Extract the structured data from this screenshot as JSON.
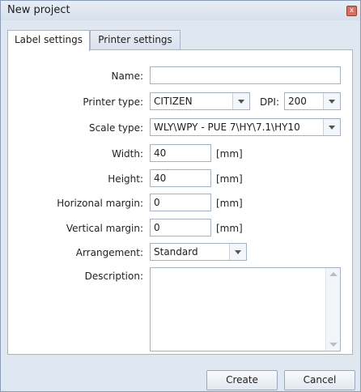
{
  "window": {
    "title": "New project"
  },
  "tabs": [
    {
      "label": "Label settings"
    },
    {
      "label": "Printer settings"
    }
  ],
  "form": {
    "name": {
      "label": "Name:",
      "value": ""
    },
    "printer_type": {
      "label": "Printer type:",
      "value": "CITIZEN"
    },
    "dpi": {
      "label": "DPI:",
      "value": "200"
    },
    "scale_type": {
      "label": "Scale type:",
      "value": "WLY\\WPY - PUE 7\\HY\\7.1\\HY10"
    },
    "width": {
      "label": "Width:",
      "value": "40",
      "unit": "[mm]"
    },
    "height": {
      "label": "Height:",
      "value": "40",
      "unit": "[mm]"
    },
    "horizontal_margin": {
      "label": "Horizonal margin:",
      "value": "0",
      "unit": "[mm]"
    },
    "vertical_margin": {
      "label": "Vertical margin:",
      "value": "0",
      "unit": "[mm]"
    },
    "arrangement": {
      "label": "Arrangement:",
      "value": "Standard"
    },
    "description": {
      "label": "Description:",
      "value": ""
    }
  },
  "buttons": {
    "create": "Create",
    "cancel": "Cancel"
  },
  "icons": {
    "close": "close-icon",
    "dropdown": "chevron-down-icon",
    "scroll_up": "scroll-up-icon",
    "scroll_down": "scroll-down-icon"
  }
}
